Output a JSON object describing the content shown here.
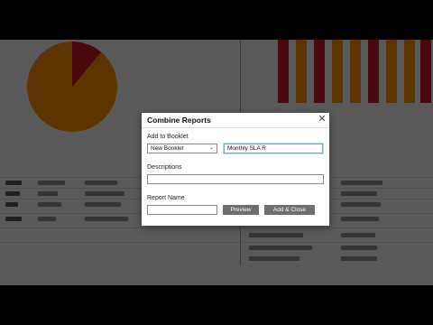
{
  "dialog": {
    "title": "Combine Reports",
    "close_icon": "close-icon",
    "add_to_booklet_label": "Add to Booklet",
    "booklet_select_value": "New Booklet",
    "booklet_name_value": "Monthly SLA R",
    "descriptions_label": "Descriptions",
    "descriptions_value": "",
    "report_name_label": "Report Name",
    "report_name_value": "",
    "preview_label": "Preview",
    "add_close_label": "Add & Close"
  },
  "colors": {
    "accent_orange": "#f08a00",
    "accent_red": "#c0151f",
    "button_gray": "#6e6e6e"
  }
}
